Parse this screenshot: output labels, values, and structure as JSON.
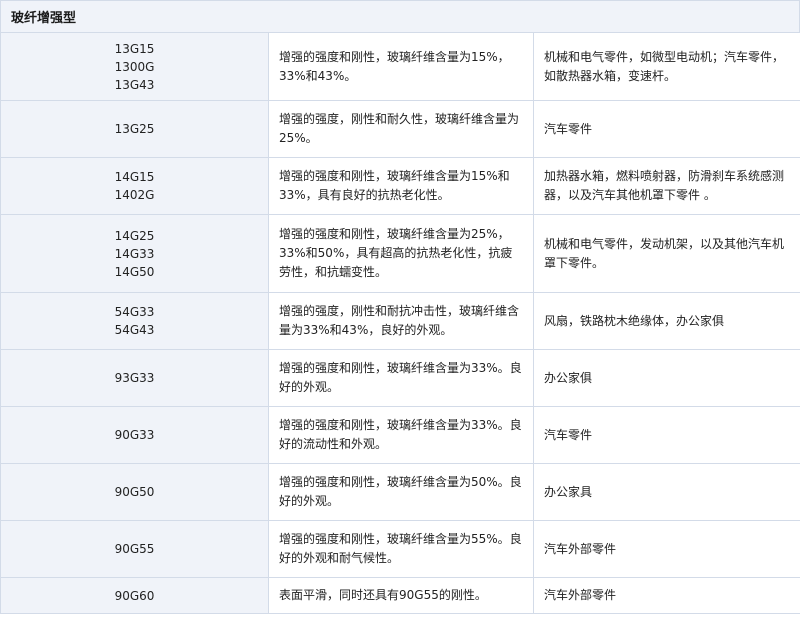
{
  "title": "玻纤增强型",
  "rows": [
    {
      "grades": [
        "13G15",
        "1300G",
        "13G43"
      ],
      "desc": "增强的强度和刚性，玻璃纤维含量为15%，33%和43%。",
      "app": "机械和电气零件，如微型电动机；汽车零件，如散热器水箱，变速杆。"
    },
    {
      "grades": [
        "13G25"
      ],
      "desc": "增强的强度，刚性和耐久性，玻璃纤维含量为25%。",
      "app": "汽车零件"
    },
    {
      "grades": [
        "14G15",
        "1402G"
      ],
      "desc": "增强的强度和刚性，玻璃纤维含量为15%和33%，具有良好的抗热老化性。",
      "app": "加热器水箱，燃料喷射器，防滑刹车系统感测器，以及汽车其他机罩下零件 。"
    },
    {
      "grades": [
        "14G25",
        "14G33",
        "14G50"
      ],
      "desc": "增强的强度和刚性，玻璃纤维含量为25%，33%和50%，具有超高的抗热老化性，抗疲劳性，和抗蠕变性。",
      "app": "机械和电气零件，发动机架，以及其他汽车机罩下零件。"
    },
    {
      "grades": [
        "54G33",
        "54G43"
      ],
      "desc": "增强的强度，刚性和耐抗冲击性，玻璃纤维含量为33%和43%，良好的外观。",
      "app": "风扇，铁路枕木绝缘体，办公家俱"
    },
    {
      "grades": [
        "93G33"
      ],
      "desc": "增强的强度和刚性，玻璃纤维含量为33%。良好的外观。",
      "app": "办公家俱"
    },
    {
      "grades": [
        "90G33"
      ],
      "desc": "增强的强度和刚性，玻璃纤维含量为33%。良好的流动性和外观。",
      "app": "汽车零件"
    },
    {
      "grades": [
        "90G50"
      ],
      "desc": "增强的强度和刚性，玻璃纤维含量为50%。良好的外观。",
      "app": "办公家具"
    },
    {
      "grades": [
        "90G55"
      ],
      "desc": "增强的强度和刚性，玻璃纤维含量为55%。良好的外观和耐气候性。",
      "app": "汽车外部零件"
    },
    {
      "grades": [
        "90G60"
      ],
      "desc": "表面平滑，同时还具有90G55的刚性。",
      "app": "汽车外部零件"
    }
  ]
}
